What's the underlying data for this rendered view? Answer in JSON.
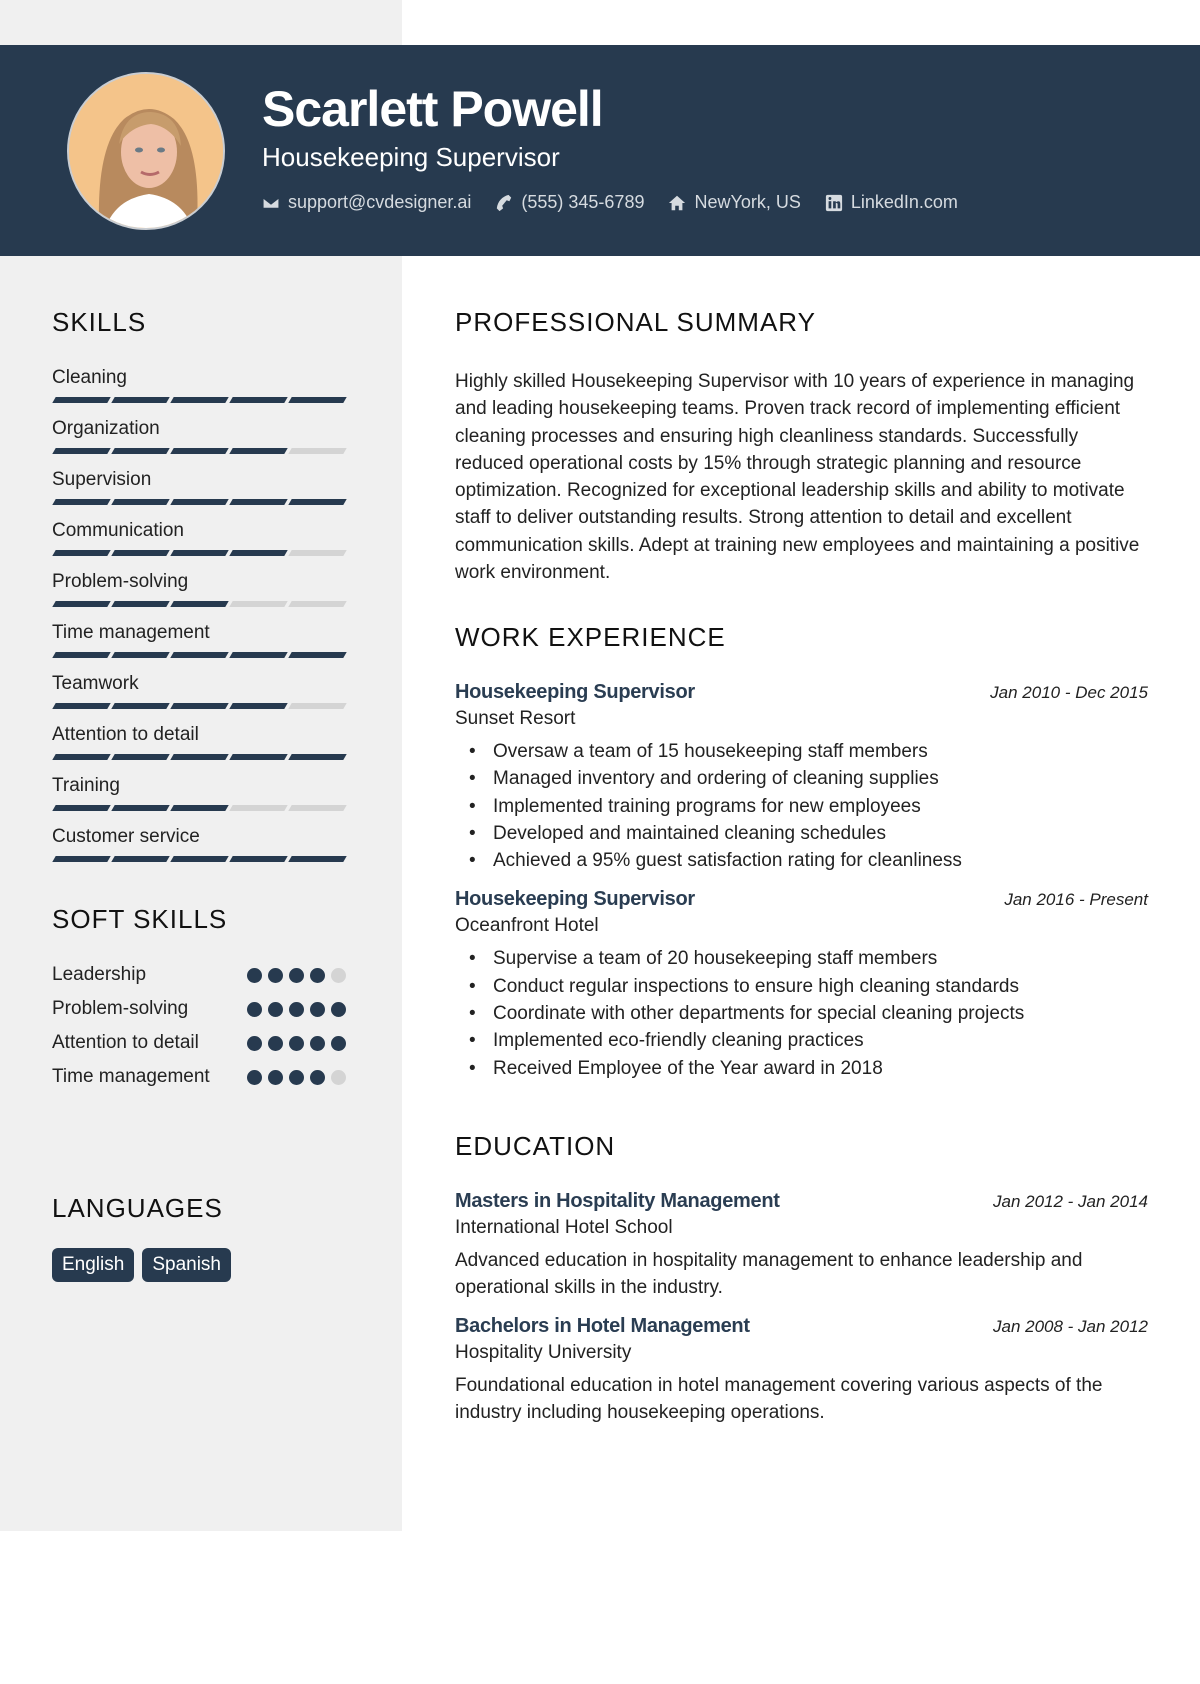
{
  "header": {
    "name": "Scarlett Powell",
    "title": "Housekeeping Supervisor",
    "contacts": [
      {
        "icon": "envelope-icon",
        "text": "support@cvdesigner.ai"
      },
      {
        "icon": "phone-icon",
        "text": "(555) 345-6789"
      },
      {
        "icon": "home-icon",
        "text": "NewYork, US"
      },
      {
        "icon": "linkedin-icon",
        "text": "LinkedIn.com"
      }
    ]
  },
  "colors": {
    "accent": "#273a4f",
    "sidebar": "#f0f0f0",
    "inactive": "#d4d4d4"
  },
  "skills": {
    "title": "SKILLS",
    "items": [
      {
        "name": "Cleaning",
        "level": 5,
        "max": 5
      },
      {
        "name": "Organization",
        "level": 4,
        "max": 5
      },
      {
        "name": "Supervision",
        "level": 5,
        "max": 5
      },
      {
        "name": "Communication",
        "level": 4,
        "max": 5
      },
      {
        "name": "Problem-solving",
        "level": 3,
        "max": 5
      },
      {
        "name": "Time management",
        "level": 5,
        "max": 5
      },
      {
        "name": "Teamwork",
        "level": 4,
        "max": 5
      },
      {
        "name": "Attention to detail",
        "level": 5,
        "max": 5
      },
      {
        "name": "Training",
        "level": 3,
        "max": 5
      },
      {
        "name": "Customer service",
        "level": 5,
        "max": 5
      }
    ]
  },
  "soft_skills": {
    "title": "SOFT SKILLS",
    "items": [
      {
        "name": "Leadership",
        "level": 4,
        "max": 5
      },
      {
        "name": "Problem-solving",
        "level": 5,
        "max": 5
      },
      {
        "name": "Attention to detail",
        "level": 5,
        "max": 5
      },
      {
        "name": "Time management",
        "level": 4,
        "max": 5
      }
    ]
  },
  "languages": {
    "title": "LANGUAGES",
    "items": [
      "English",
      "Spanish"
    ]
  },
  "summary": {
    "title": "PROFESSIONAL SUMMARY",
    "text": "Highly skilled Housekeeping Supervisor with 10 years of experience in managing and leading housekeeping teams. Proven track record of implementing efficient cleaning processes and ensuring high cleanliness standards. Successfully reduced operational costs by 15% through strategic planning and resource optimization. Recognized for exceptional leadership skills and ability to motivate staff to deliver outstanding results. Strong attention to detail and excellent communication skills. Adept at training new employees and maintaining a positive work environment."
  },
  "work": {
    "title": "WORK EXPERIENCE",
    "jobs": [
      {
        "title": "Housekeeping Supervisor",
        "date": "Jan 2010 - Dec 2015",
        "company": "Sunset Resort",
        "bullets": [
          "Oversaw a team of 15 housekeeping staff members",
          "Managed inventory and ordering of cleaning supplies",
          "Implemented training programs for new employees",
          "Developed and maintained cleaning schedules",
          "Achieved a 95% guest satisfaction rating for cleanliness"
        ]
      },
      {
        "title": "Housekeeping Supervisor",
        "date": "Jan 2016 - Present",
        "company": "Oceanfront Hotel",
        "bullets": [
          "Supervise a team of 20 housekeeping staff members",
          "Conduct regular inspections to ensure high cleaning standards",
          "Coordinate with other departments for special cleaning projects",
          "Implemented eco-friendly cleaning practices",
          "Received Employee of the Year award in 2018"
        ]
      }
    ]
  },
  "education": {
    "title": "EDUCATION",
    "items": [
      {
        "degree": "Masters in Hospitality Management",
        "date": "Jan 2012 - Jan 2014",
        "school": "International Hotel School",
        "description": "Advanced education in hospitality management to enhance leadership and operational skills in the industry."
      },
      {
        "degree": "Bachelors in Hotel Management",
        "date": "Jan 2008 - Jan 2012",
        "school": "Hospitality University",
        "description": "Foundational education in hotel management covering various aspects of the industry including housekeeping operations."
      }
    ]
  }
}
